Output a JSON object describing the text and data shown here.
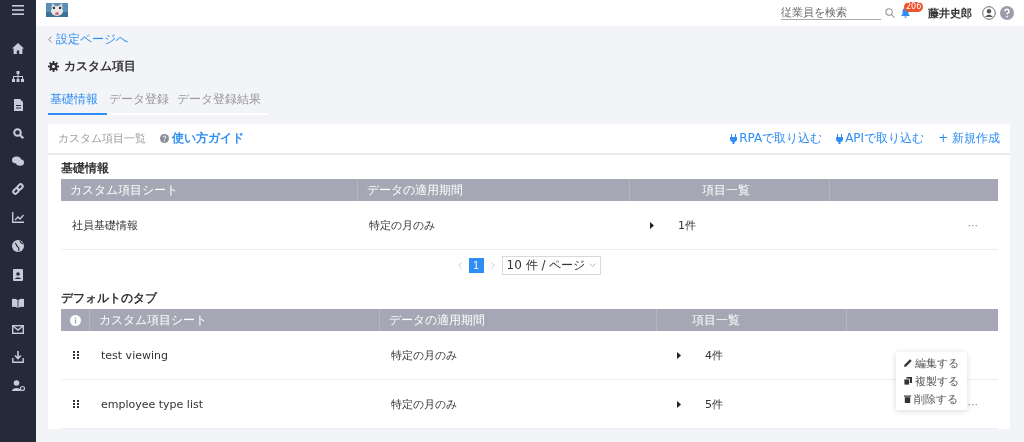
{
  "header": {
    "search": {
      "placeholder": "従業員を検索"
    },
    "notifications": "206",
    "user_name": "藤井史郎"
  },
  "breadcrumb": "設定ページへ",
  "page_title": "カスタム項目",
  "tabs": [
    {
      "label": "基礎情報",
      "selected": true
    },
    {
      "label": "データ登録",
      "selected": false
    },
    {
      "label": "データ登録結果",
      "selected": false
    }
  ],
  "card": {
    "title": "カスタム項目一覧",
    "guide_link": "使い方ガイド",
    "actions": [
      {
        "label": "RPAで取り込む",
        "kind": "plug"
      },
      {
        "label": "APIで取り込む",
        "kind": "plug"
      },
      {
        "label": "+ 新規作成",
        "kind": "plain"
      }
    ]
  },
  "basic_section": {
    "title": "基礎情報",
    "columns": [
      "カスタム項目シート",
      "データの適用期間",
      "項目一覧"
    ],
    "rows": [
      {
        "sheet": "社員基礎情報",
        "period": "特定の月のみ",
        "count": "1件",
        "more": "···"
      }
    ],
    "pagination": {
      "pages": [
        {
          "label": "1",
          "selected": true
        }
      ],
      "page_size": "10 件 / ページ"
    }
  },
  "default_section": {
    "title": "デフォルトのタブ",
    "columns": [
      "カスタム項目シート",
      "データの適用期間",
      "項目一覧"
    ],
    "rows": [
      {
        "sheet": "test viewing",
        "period": "特定の月のみ",
        "count": "4件"
      },
      {
        "sheet": "employee type list",
        "period": "特定の月のみ",
        "count": "5件",
        "more": "···"
      }
    ]
  },
  "row_menu": [
    {
      "label": "編集する",
      "kind": "edit"
    },
    {
      "label": "複製する",
      "kind": "copy"
    },
    {
      "label": "削除する",
      "kind": "delete"
    }
  ]
}
